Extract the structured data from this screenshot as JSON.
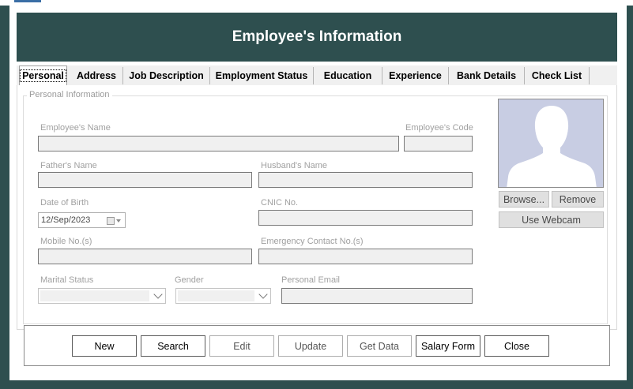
{
  "header": {
    "title": "Employee's Information"
  },
  "tabs": [
    {
      "label": "Personal",
      "active": true
    },
    {
      "label": "Address"
    },
    {
      "label": "Job Description"
    },
    {
      "label": "Employment Status"
    },
    {
      "label": "Education"
    },
    {
      "label": "Experience"
    },
    {
      "label": "Bank Details"
    },
    {
      "label": "Check List"
    }
  ],
  "personal": {
    "group_title": "Personal Information",
    "employee_name_label": "Employee's Name",
    "employee_code_label": "Employee's Code",
    "father_name_label": "Father's Name",
    "husband_name_label": "Husband's Name",
    "dob_label": "Date of Birth",
    "dob_value": "12/Sep/2023",
    "cnic_label": "CNIC No.",
    "mobile_label": "Mobile No.(s)",
    "emergency_label": "Emergency Contact No.(s)",
    "marital_label": "Marital Status",
    "gender_label": "Gender",
    "email_label": "Personal Email",
    "employee_name": "",
    "employee_code": "",
    "father_name": "",
    "husband_name": "",
    "cnic": "",
    "mobile": "",
    "emergency": "",
    "marital_status": "",
    "gender": "",
    "email": ""
  },
  "photo": {
    "browse_label": "Browse...",
    "remove_label": "Remove",
    "webcam_label": "Use Webcam",
    "placeholder_icon": "person-silhouette-icon"
  },
  "actions": {
    "new": "New",
    "search": "Search",
    "edit": "Edit",
    "update": "Update",
    "get_data": "Get Data",
    "salary_form": "Salary Form",
    "close": "Close"
  },
  "colors": {
    "header_bg": "#2e4f4f",
    "header_text": "#ffffff",
    "photo_bg": "#c8cde3",
    "silhouette": "#ffffff"
  }
}
